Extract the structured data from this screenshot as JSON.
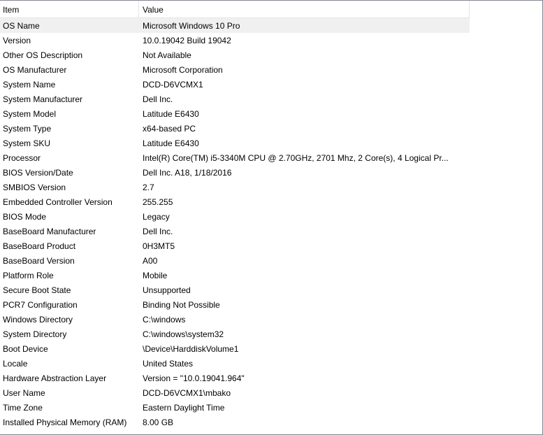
{
  "columns": {
    "item": "Item",
    "value": "Value"
  },
  "selected_row": 0,
  "rows": [
    {
      "item": "OS Name",
      "value": "Microsoft Windows 10 Pro"
    },
    {
      "item": "Version",
      "value": "10.0.19042 Build 19042"
    },
    {
      "item": "Other OS Description",
      "value": "Not Available"
    },
    {
      "item": "OS Manufacturer",
      "value": "Microsoft Corporation"
    },
    {
      "item": "System Name",
      "value": "DCD-D6VCMX1"
    },
    {
      "item": "System Manufacturer",
      "value": "Dell Inc."
    },
    {
      "item": "System Model",
      "value": "Latitude E6430"
    },
    {
      "item": "System Type",
      "value": "x64-based PC"
    },
    {
      "item": "System SKU",
      "value": "Latitude E6430"
    },
    {
      "item": "Processor",
      "value": "Intel(R) Core(TM) i5-3340M CPU @ 2.70GHz, 2701 Mhz, 2 Core(s), 4 Logical Pr..."
    },
    {
      "item": "BIOS Version/Date",
      "value": "Dell Inc. A18, 1/18/2016"
    },
    {
      "item": "SMBIOS Version",
      "value": "2.7"
    },
    {
      "item": "Embedded Controller Version",
      "value": "255.255"
    },
    {
      "item": "BIOS Mode",
      "value": "Legacy"
    },
    {
      "item": "BaseBoard Manufacturer",
      "value": "Dell Inc."
    },
    {
      "item": "BaseBoard Product",
      "value": "0H3MT5"
    },
    {
      "item": "BaseBoard Version",
      "value": "A00"
    },
    {
      "item": "Platform Role",
      "value": "Mobile"
    },
    {
      "item": "Secure Boot State",
      "value": "Unsupported"
    },
    {
      "item": "PCR7 Configuration",
      "value": "Binding Not Possible"
    },
    {
      "item": "Windows Directory",
      "value": "C:\\windows"
    },
    {
      "item": "System Directory",
      "value": "C:\\windows\\system32"
    },
    {
      "item": "Boot Device",
      "value": "\\Device\\HarddiskVolume1"
    },
    {
      "item": "Locale",
      "value": "United States"
    },
    {
      "item": "Hardware Abstraction Layer",
      "value": "Version = \"10.0.19041.964\""
    },
    {
      "item": "User Name",
      "value": "DCD-D6VCMX1\\mbako"
    },
    {
      "item": "Time Zone",
      "value": "Eastern Daylight Time"
    },
    {
      "item": "Installed Physical Memory (RAM)",
      "value": "8.00 GB"
    }
  ]
}
